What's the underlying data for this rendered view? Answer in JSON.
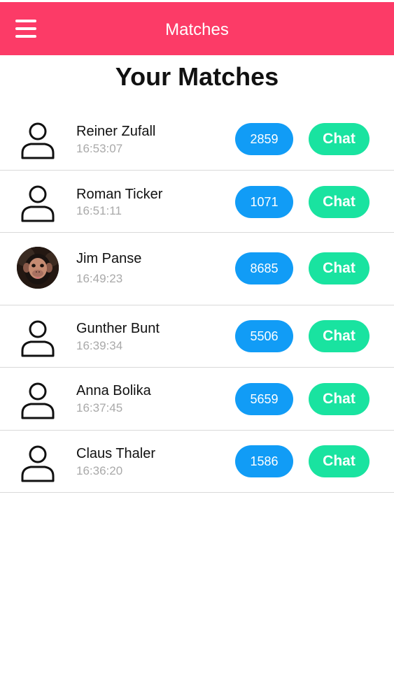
{
  "header": {
    "title": "Matches",
    "menu_icon": "hamburger-menu-icon",
    "background_color": "#fc3b67"
  },
  "page": {
    "title": "Your Matches"
  },
  "colors": {
    "score_button": "#119cf6",
    "chat_button": "#19e3a0",
    "divider": "#d9d9d9",
    "time_text": "#a9a9a9"
  },
  "matches": [
    {
      "name": "Reiner Zufall",
      "time": "16:53:07",
      "score": "2859",
      "chat_label": "Chat",
      "avatar": "user-outline-icon"
    },
    {
      "name": "Roman Ticker",
      "time": "16:51:11",
      "score": "1071",
      "chat_label": "Chat",
      "avatar": "user-outline-icon"
    },
    {
      "name": "Jim Panse",
      "time": "16:49:23",
      "score": "8685",
      "chat_label": "Chat",
      "avatar": "chimpanzee-photo"
    },
    {
      "name": "Gunther Bunt",
      "time": "16:39:34",
      "score": "5506",
      "chat_label": "Chat",
      "avatar": "user-outline-icon"
    },
    {
      "name": "Anna Bolika",
      "time": "16:37:45",
      "score": "5659",
      "chat_label": "Chat",
      "avatar": "user-outline-icon"
    },
    {
      "name": "Claus Thaler",
      "time": "16:36:20",
      "score": "1586",
      "chat_label": "Chat",
      "avatar": "user-outline-icon"
    }
  ]
}
